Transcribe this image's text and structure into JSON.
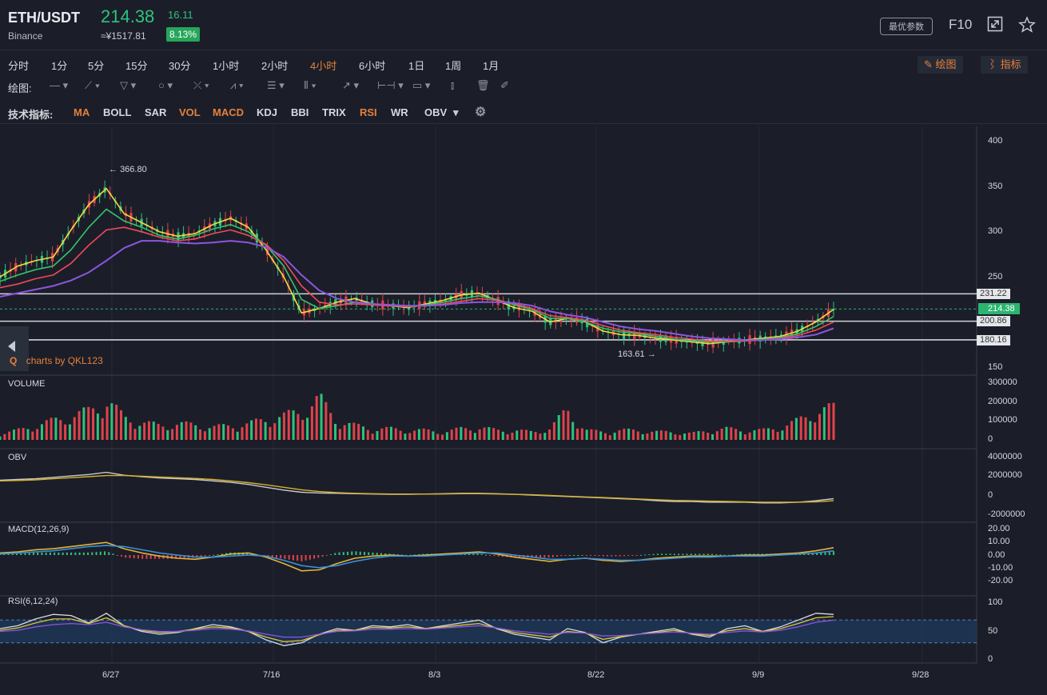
{
  "header": {
    "symbol": "ETH/USDT",
    "exchange": "Binance",
    "price": "214.38",
    "change": "16.11",
    "cny": "≈¥1517.81",
    "change_pct": "8.13%",
    "best_params": "最优参数",
    "f10": "F10",
    "icons": [
      "expand-icon",
      "star-icon"
    ]
  },
  "intervals": [
    "分时",
    "1分",
    "5分",
    "15分",
    "30分",
    "1小时",
    "2小时",
    "4小时",
    "6小时",
    "1日",
    "1周",
    "1月"
  ],
  "active_interval": "4小时",
  "toolbar": {
    "draw_label": "绘图",
    "indicator_label": "指标"
  },
  "drawing": {
    "label": "绘图:"
  },
  "indicators": {
    "label": "技术指标:",
    "items": [
      "MA",
      "BOLL",
      "SAR",
      "VOL",
      "MACD",
      "KDJ",
      "BBI",
      "TRIX",
      "RSI",
      "WR",
      "OBV"
    ],
    "active": [
      "MA",
      "VOL",
      "MACD",
      "RSI"
    ]
  },
  "watermark": "charts by QKL123",
  "colors": {
    "up": "#2ec27e",
    "down": "#e0424a",
    "accent": "#e5803a",
    "bg": "#1b1e29"
  },
  "chart_data": [
    {
      "type": "line",
      "panel": "price",
      "ylim": [
        150,
        400
      ],
      "y_ticks": [
        "400",
        "350",
        "300",
        "250",
        "150"
      ],
      "x_ticks": [
        "6/27",
        "7/16",
        "8/3",
        "8/22",
        "9/9",
        "9/28"
      ],
      "annotations": {
        "high": "366.80",
        "low": "163.61"
      },
      "levels": [
        "231.22",
        "200.86",
        "180.16"
      ],
      "current_price": "214.38",
      "series": [
        {
          "values": [
            250,
            262,
            268,
            272,
            302,
            330,
            348,
            320,
            310,
            300,
            295,
            298,
            308,
            315,
            305,
            280,
            250,
            210,
            215,
            222,
            226,
            220,
            218,
            216,
            220,
            224,
            230,
            232,
            224,
            216,
            212,
            200,
            204,
            200,
            190,
            186,
            185,
            182,
            180,
            178,
            176,
            178,
            180,
            182,
            184,
            190,
            200,
            214
          ]
        },
        {
          "values": [
            245,
            252,
            258,
            262,
            280,
            305,
            325,
            312,
            305,
            296,
            292,
            296,
            303,
            308,
            300,
            285,
            262,
            225,
            215,
            218,
            222,
            219,
            218,
            217,
            219,
            222,
            226,
            229,
            225,
            219,
            214,
            204,
            204,
            200,
            193,
            189,
            187,
            184,
            181,
            179,
            178,
            178,
            179,
            181,
            183,
            187,
            195,
            206
          ]
        },
        {
          "values": [
            238,
            242,
            248,
            252,
            265,
            285,
            302,
            305,
            300,
            294,
            290,
            292,
            298,
            302,
            296,
            286,
            268,
            240,
            222,
            219,
            220,
            219,
            218,
            217,
            218,
            220,
            223,
            226,
            224,
            220,
            215,
            207,
            205,
            202,
            196,
            191,
            188,
            186,
            183,
            181,
            179,
            179,
            179,
            180,
            182,
            185,
            191,
            200
          ]
        },
        {
          "values": [
            228,
            232,
            236,
            240,
            246,
            255,
            268,
            282,
            290,
            290,
            288,
            287,
            288,
            290,
            288,
            283,
            272,
            252,
            235,
            226,
            222,
            220,
            219,
            218,
            218,
            219,
            221,
            222,
            222,
            221,
            218,
            212,
            208,
            205,
            200,
            195,
            192,
            190,
            187,
            184,
            182,
            181,
            180,
            180,
            181,
            183,
            186,
            193
          ]
        }
      ],
      "series_colors": [
        "#f5d742",
        "#35c46b",
        "#ef4a5a",
        "#8d55e0"
      ]
    },
    {
      "type": "bar",
      "panel": "VOLUME",
      "title": "VOLUME",
      "y_ticks": [
        "300000",
        "200000",
        "100000",
        "0"
      ],
      "ylim": [
        0,
        300000
      ],
      "values": [
        40000,
        60000,
        90000,
        120000,
        150000,
        180000,
        250000,
        140000,
        110000,
        90000,
        100000,
        95000,
        80000,
        90000,
        100000,
        130000,
        150000,
        180000,
        260000,
        120000,
        90000,
        70000,
        70000,
        60000,
        60000,
        50000,
        70000,
        80000,
        60000,
        60000,
        50000,
        70000,
        190000,
        60000,
        50000,
        60000,
        60000,
        50000,
        50000,
        40000,
        60000,
        70000,
        60000,
        60000,
        80000,
        120000,
        180000,
        200000
      ]
    },
    {
      "type": "line",
      "panel": "OBV",
      "title": "OBV",
      "y_ticks": [
        "4000000",
        "2000000",
        "0",
        "-2000000"
      ],
      "ylim": [
        -3000000,
        5000000
      ],
      "series": [
        {
          "values": [
            1800000,
            1900000,
            2000000,
            2200000,
            2400000,
            2600000,
            2900000,
            2500000,
            2300000,
            2100000,
            2000000,
            1900000,
            1700000,
            1500000,
            1200000,
            800000,
            400000,
            100000,
            0,
            -50000,
            -100000,
            -150000,
            -200000,
            -200000,
            -150000,
            -100000,
            -50000,
            -50000,
            -100000,
            -200000,
            -300000,
            -400000,
            -500000,
            -600000,
            -700000,
            -800000,
            -900000,
            -1100000,
            -1200000,
            -1200000,
            -1300000,
            -1300000,
            -1300000,
            -1400000,
            -1400000,
            -1300000,
            -1100000,
            -800000
          ]
        },
        {
          "values": [
            1700000,
            1750000,
            1850000,
            2000000,
            2150000,
            2300000,
            2450000,
            2450000,
            2350000,
            2250000,
            2150000,
            2050000,
            1900000,
            1700000,
            1450000,
            1150000,
            800000,
            450000,
            200000,
            50000,
            -50000,
            -100000,
            -150000,
            -150000,
            -150000,
            -150000,
            -100000,
            -100000,
            -150000,
            -200000,
            -250000,
            -350000,
            -450000,
            -550000,
            -650000,
            -750000,
            -850000,
            -950000,
            -1050000,
            -1100000,
            -1150000,
            -1200000,
            -1250000,
            -1300000,
            -1300000,
            -1300000,
            -1250000,
            -1100000
          ]
        }
      ],
      "series_colors": [
        "#c7c9d1",
        "#d9b02c"
      ]
    },
    {
      "type": "line",
      "panel": "MACD",
      "title": "MACD(12,26,9)",
      "y_ticks": [
        "20.00",
        "10.00",
        "0.00",
        "-10.00",
        "-20.00"
      ],
      "ylim": [
        -25,
        25
      ],
      "series": [
        {
          "values": [
            2,
            3,
            5,
            6,
            8,
            10,
            12,
            6,
            2,
            -1,
            -3,
            -4,
            -2,
            1,
            2,
            -2,
            -8,
            -15,
            -14,
            -8,
            -3,
            -1,
            0,
            -1,
            0,
            1,
            2,
            3,
            1,
            -2,
            -4,
            -6,
            -4,
            -3,
            -5,
            -6,
            -5,
            -3,
            -2,
            -1,
            -1,
            -1,
            0,
            0,
            1,
            2,
            4,
            7
          ]
        },
        {
          "values": [
            1,
            2,
            3,
            4,
            6,
            8,
            9,
            8,
            5,
            2,
            0,
            -2,
            -2,
            -1,
            0,
            -1,
            -5,
            -10,
            -12,
            -10,
            -6,
            -3,
            -1,
            -1,
            -1,
            0,
            1,
            2,
            2,
            0,
            -2,
            -4,
            -4,
            -3,
            -4,
            -5,
            -5,
            -4,
            -3,
            -2,
            -2,
            -1,
            -1,
            -1,
            0,
            1,
            2,
            4
          ]
        }
      ],
      "series_colors": [
        "#e0b43a",
        "#3b8fd9"
      ]
    },
    {
      "type": "line",
      "panel": "RSI",
      "title": "RSI(6,12,24)",
      "y_ticks": [
        "100",
        "50",
        "0"
      ],
      "ylim": [
        0,
        100
      ],
      "band": [
        30,
        70
      ],
      "series": [
        {
          "values": [
            55,
            60,
            72,
            80,
            78,
            65,
            82,
            60,
            50,
            45,
            48,
            55,
            62,
            58,
            50,
            35,
            25,
            30,
            45,
            55,
            52,
            60,
            58,
            62,
            55,
            60,
            65,
            70,
            55,
            45,
            40,
            35,
            55,
            48,
            30,
            40,
            45,
            50,
            55,
            45,
            40,
            55,
            60,
            50,
            58,
            70,
            82,
            80
          ]
        },
        {
          "values": [
            52,
            56,
            65,
            72,
            72,
            64,
            74,
            60,
            52,
            48,
            50,
            54,
            58,
            56,
            50,
            40,
            32,
            34,
            44,
            52,
            52,
            57,
            56,
            58,
            55,
            58,
            61,
            64,
            56,
            48,
            44,
            40,
            50,
            47,
            36,
            41,
            45,
            48,
            52,
            46,
            43,
            51,
            55,
            50,
            55,
            64,
            74,
            76
          ]
        },
        {
          "values": [
            50,
            52,
            58,
            62,
            64,
            62,
            66,
            58,
            53,
            50,
            50,
            52,
            55,
            54,
            51,
            45,
            40,
            40,
            45,
            50,
            51,
            54,
            54,
            55,
            54,
            56,
            58,
            60,
            56,
            51,
            48,
            45,
            48,
            47,
            42,
            43,
            45,
            47,
            49,
            47,
            45,
            48,
            51,
            49,
            52,
            58,
            66,
            70
          ]
        }
      ],
      "series_colors": [
        "#d8dae0",
        "#e0c53a",
        "#8d55e0"
      ]
    }
  ]
}
